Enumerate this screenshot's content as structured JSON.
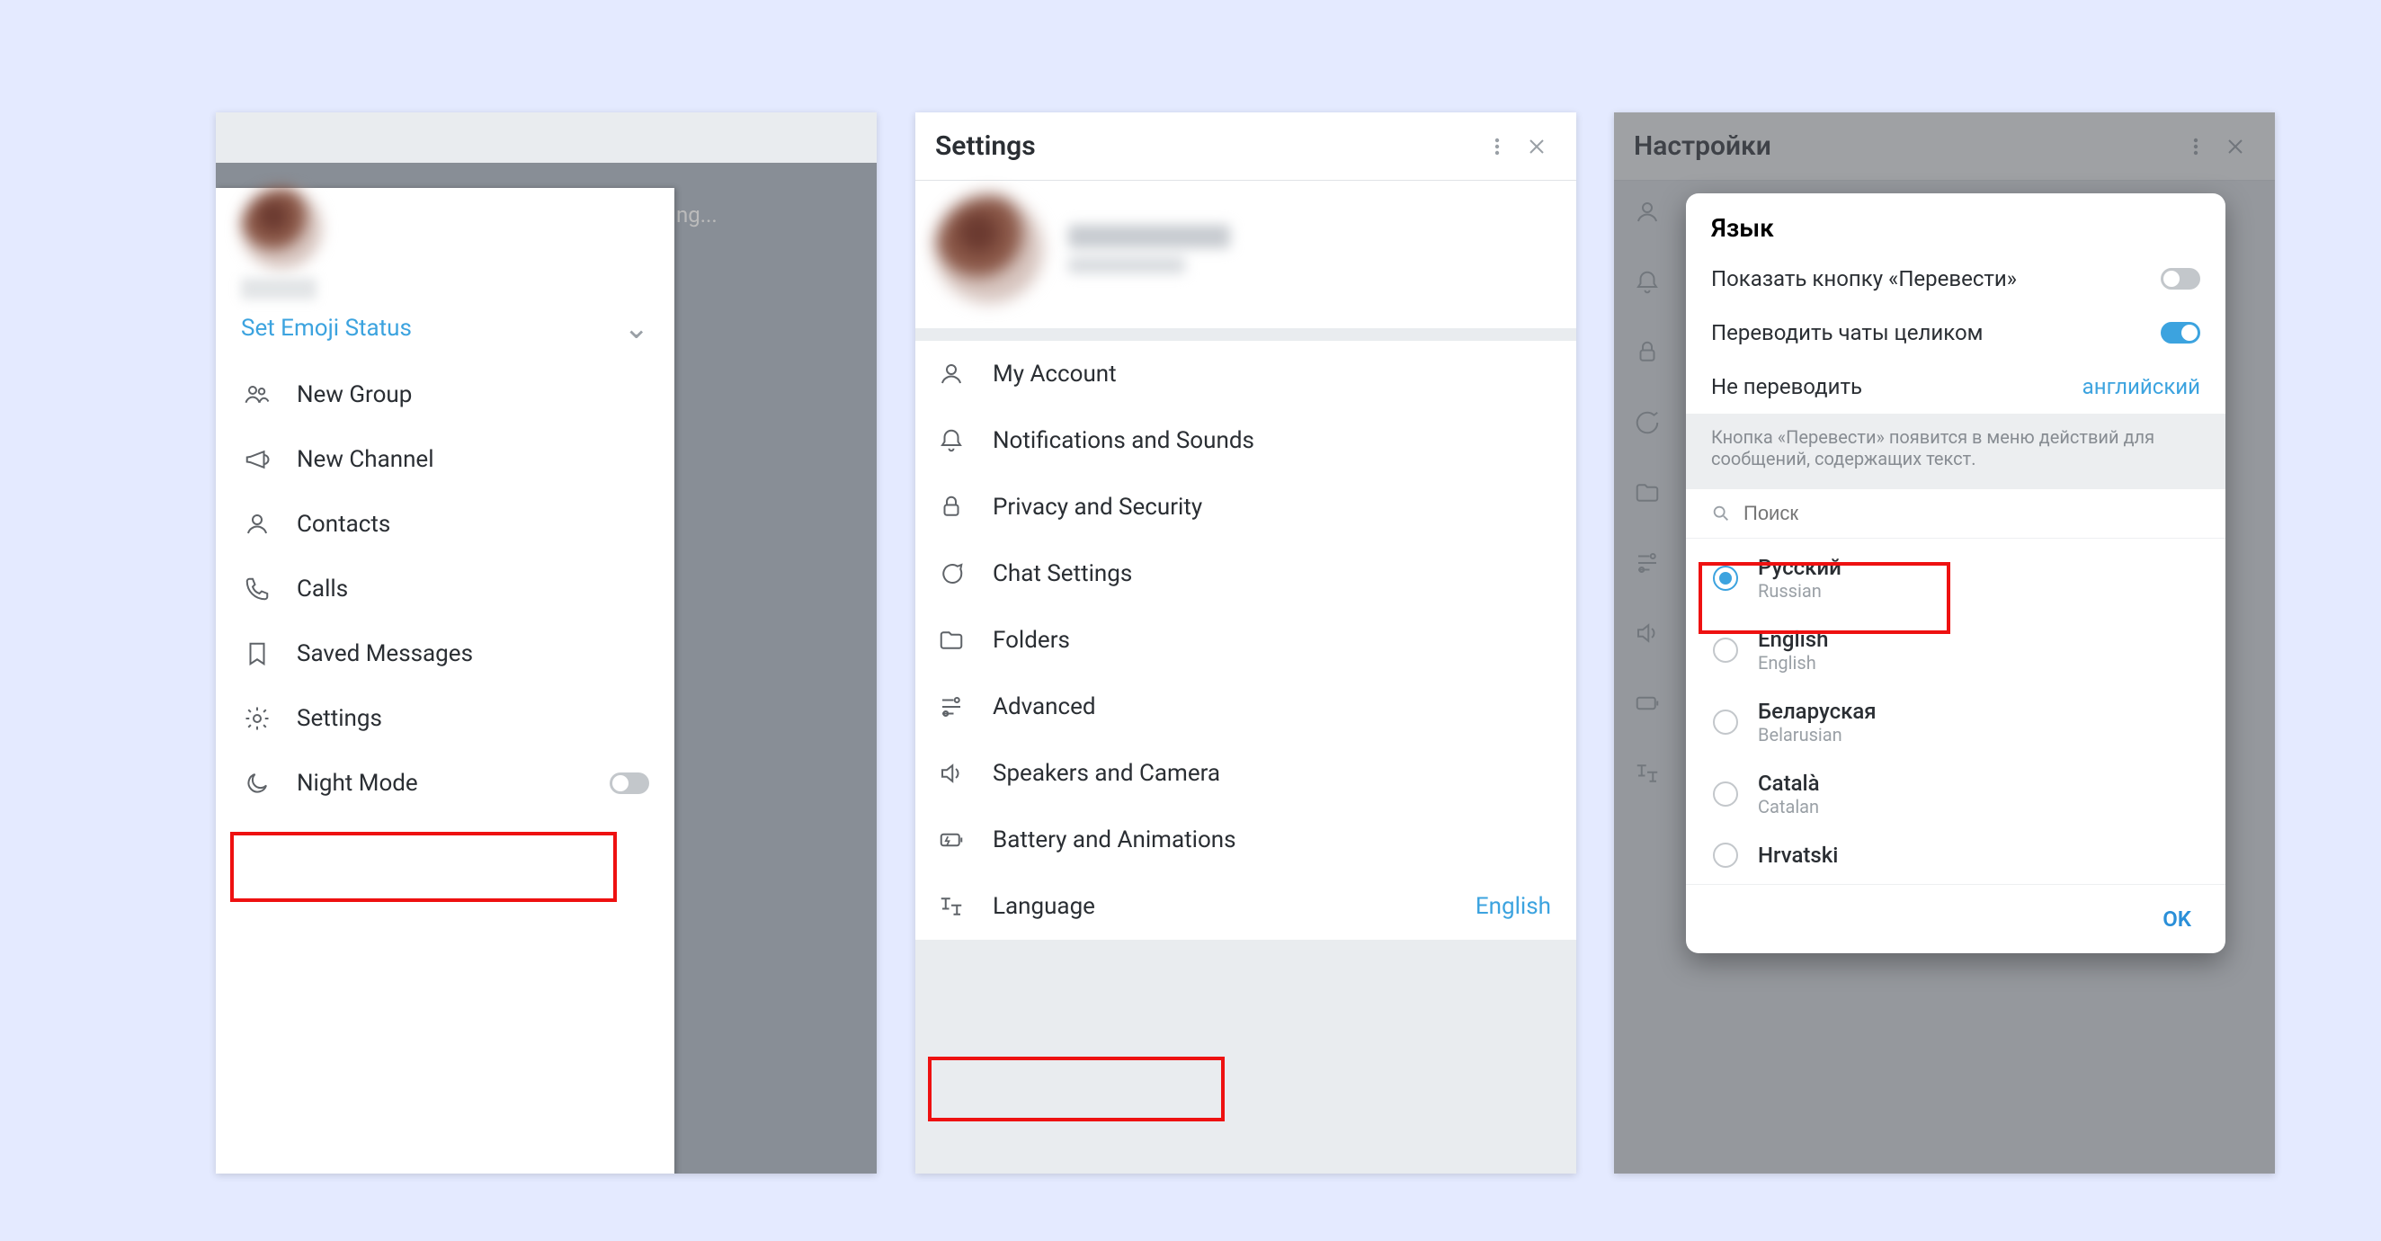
{
  "panel1": {
    "set_emoji_status": "Set Emoji Status",
    "bg_text": "ng...",
    "menu": [
      {
        "icon": "group",
        "label": "New Group"
      },
      {
        "icon": "megaphone",
        "label": "New Channel"
      },
      {
        "icon": "user",
        "label": "Contacts"
      },
      {
        "icon": "phone",
        "label": "Calls"
      },
      {
        "icon": "bookmark",
        "label": "Saved Messages"
      },
      {
        "icon": "gear",
        "label": "Settings"
      },
      {
        "icon": "moon",
        "label": "Night Mode",
        "toggle": false
      }
    ]
  },
  "panel2": {
    "title": "Settings",
    "items": [
      {
        "icon": "user",
        "label": "My Account"
      },
      {
        "icon": "bell",
        "label": "Notifications and Sounds"
      },
      {
        "icon": "lock",
        "label": "Privacy and Security"
      },
      {
        "icon": "chat",
        "label": "Chat Settings"
      },
      {
        "icon": "folder",
        "label": "Folders"
      },
      {
        "icon": "sliders",
        "label": "Advanced"
      },
      {
        "icon": "speaker",
        "label": "Speakers and Camera"
      },
      {
        "icon": "battery",
        "label": "Battery and Animations"
      },
      {
        "icon": "translate",
        "label": "Language",
        "value": "English"
      }
    ]
  },
  "panel3": {
    "bg_title": "Настройки",
    "card": {
      "title": "Язык",
      "show_translate": "Показать кнопку «Перевести»",
      "translate_whole": "Переводить чаты целиком",
      "dont_translate_label": "Не переводить",
      "dont_translate_value": "английский",
      "translate_whole_on": true,
      "note": "Кнопка «Перевести» появится в меню действий для сообщений, содержащих текст.",
      "search_placeholder": "Поиск",
      "ok": "OK"
    },
    "languages": [
      {
        "native": "Русский",
        "english": "Russian",
        "selected": true
      },
      {
        "native": "English",
        "english": "English",
        "selected": false
      },
      {
        "native": "Беларуская",
        "english": "Belarusian",
        "selected": false
      },
      {
        "native": "Català",
        "english": "Catalan",
        "selected": false
      },
      {
        "native": "Hrvatski",
        "english": "",
        "selected": false
      }
    ]
  }
}
